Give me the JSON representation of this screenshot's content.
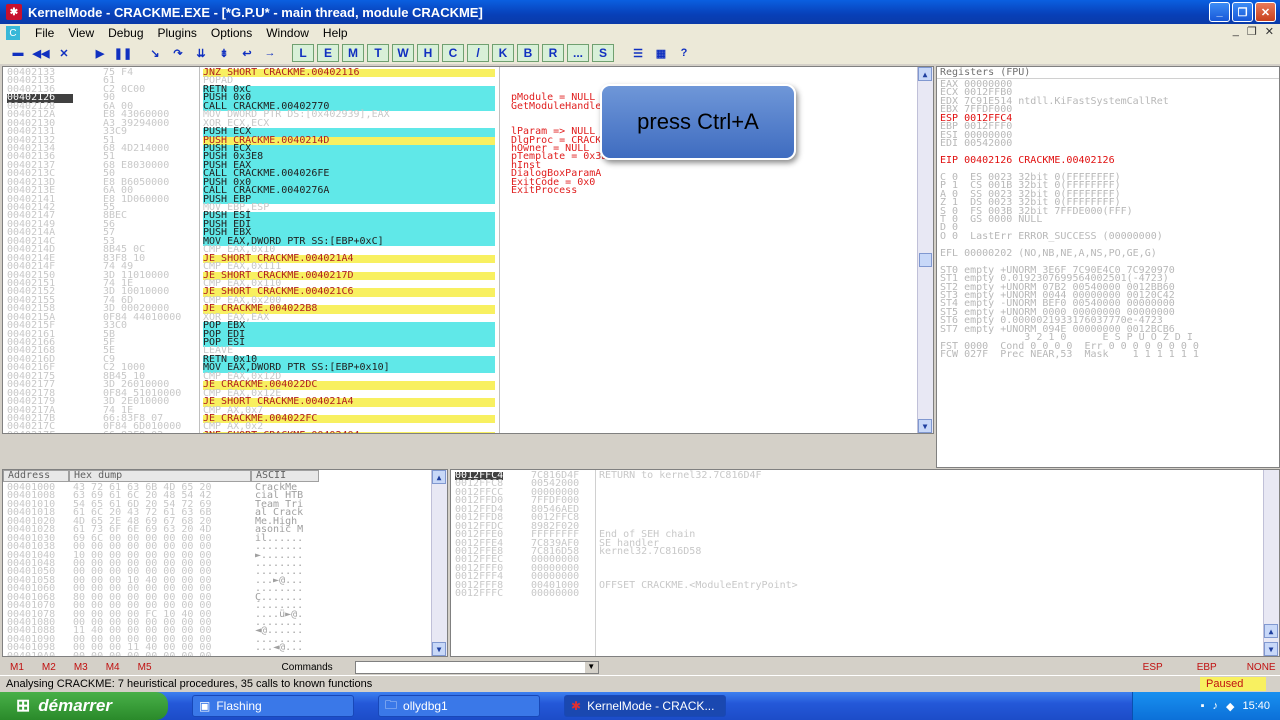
{
  "window": {
    "title": "KernelMode - CRACKME.EXE - [*G.P.U* - main thread, module CRACKME]",
    "icon": "bug-icon"
  },
  "menu": [
    "File",
    "View",
    "Debug",
    "Plugins",
    "Options",
    "Window",
    "Help"
  ],
  "toolbar_letters": [
    "L",
    "E",
    "M",
    "T",
    "W",
    "H",
    "C",
    "/",
    "K",
    "B",
    "R",
    "...",
    "S"
  ],
  "callout": "press  Ctrl+A",
  "disasm": {
    "addresses": [
      "00402133",
      "00402135",
      "00402136",
      "00402126",
      "00402128",
      "0040212A",
      "00402130",
      "00402131",
      "00402132",
      "00402134",
      "00402136",
      "00402137",
      "0040213C",
      "0040213D",
      "0040213E",
      "00402141",
      "00402142",
      "00402147",
      "00402149",
      "0040214A",
      "0040214C",
      "0040214D",
      "0040214E",
      "0040214F",
      "00402150",
      "00402151",
      "00402152",
      "00402155",
      "00402158",
      "0040215A",
      "0040215F",
      "00402161",
      "00402166",
      "00402168",
      "0040216D",
      "0040216F",
      "00402175",
      "00402177",
      "00402178",
      "00402179",
      "0040217A",
      "0040217B",
      "0040217C",
      "0040217F",
      "00402182",
      "00402187",
      "0040218D",
      "00402192",
      "00402194",
      "00402197",
      "0040219D",
      "004021A0",
      "004021A2",
      "004021A3",
      "004021A5"
    ],
    "hex": [
      "75 F4",
      "61",
      "C2 0C00",
      "90",
      "6A 00",
      "E8 43060000",
      "A3 39294000",
      "33C9",
      "51",
      "68 4D214000",
      "51",
      "68 E8030000",
      "50",
      "E8 B6050000",
      "6A 00",
      "E8 1D060000",
      "55",
      "8BEC",
      "56",
      "57",
      "53",
      "8B45 0C",
      "83F8 10",
      "74 49",
      "3D 11010000",
      "74 1E",
      "3D 10010000",
      "74 6D",
      "3D 00020000",
      "0F84 44010000",
      "33C0",
      "5B",
      "5F",
      "5E",
      "C9",
      "C2 1000",
      "8B45 10",
      "3D 26010000",
      "0F84 51010000",
      "3D 2E010000",
      "74 1E",
      "66:83F8 07",
      "0F84 6D010000",
      "66:83F8 02",
      "33 C9"
    ],
    "instr": [
      {
        "t": "JNZ SHORT CRACKME.00402116",
        "k": "y"
      },
      {
        "t": "POPAD",
        "k": ""
      },
      {
        "t": "RETN 0xC",
        "k": "c"
      },
      {
        "t": "PUSH 0x0",
        "k": "c"
      },
      {
        "t": "CALL CRACKME.00402770",
        "k": "c"
      },
      {
        "t": "MOV DWORD PTR DS:[0x402939],EAX",
        "k": ""
      },
      {
        "t": "XOR ECX,ECX",
        "k": ""
      },
      {
        "t": "PUSH ECX",
        "k": "c"
      },
      {
        "t": "PUSH CRACKME.0040214D",
        "k": "y"
      },
      {
        "t": "PUSH ECX",
        "k": "c"
      },
      {
        "t": "PUSH 0x3E8",
        "k": "c"
      },
      {
        "t": "PUSH EAX",
        "k": "c"
      },
      {
        "t": "CALL CRACKME.004026FE",
        "k": "c"
      },
      {
        "t": "PUSH 0x0",
        "k": "c"
      },
      {
        "t": "CALL CRACKME.0040276A",
        "k": "c"
      },
      {
        "t": "PUSH EBP",
        "k": "c"
      },
      {
        "t": "MOV EBP,ESP",
        "k": ""
      },
      {
        "t": "PUSH ESI",
        "k": "c"
      },
      {
        "t": "PUSH EDI",
        "k": "c"
      },
      {
        "t": "PUSH EBX",
        "k": "c"
      },
      {
        "t": "MOV EAX,DWORD PTR SS:[EBP+0xC]",
        "k": "c"
      },
      {
        "t": "CMP EAX,0x10",
        "k": ""
      },
      {
        "t": "JE SHORT CRACKME.004021A4",
        "k": "y"
      },
      {
        "t": "CMP EAX,0x111",
        "k": ""
      },
      {
        "t": "JE SHORT CRACKME.0040217D",
        "k": "y"
      },
      {
        "t": "CMP EAX,0x110",
        "k": ""
      },
      {
        "t": "JE SHORT CRACKME.004021C6",
        "k": "y"
      },
      {
        "t": "CMP EAX,0x200",
        "k": ""
      },
      {
        "t": "JE CRACKME.004022B8",
        "k": "y"
      },
      {
        "t": "XOR EAX,EAX",
        "k": ""
      },
      {
        "t": "POP EBX",
        "k": "c"
      },
      {
        "t": "POP EDI",
        "k": "c"
      },
      {
        "t": "POP ESI",
        "k": "c"
      },
      {
        "t": "LEAVE",
        "k": ""
      },
      {
        "t": "RETN 0x10",
        "k": "c"
      },
      {
        "t": "MOV EAX,DWORD PTR SS:[EBP+0x10]",
        "k": "c"
      },
      {
        "t": "CMP EAX,0x12D",
        "k": ""
      },
      {
        "t": "JE CRACKME.004022DC",
        "k": "y"
      },
      {
        "t": "CMP EAX,0x12E",
        "k": ""
      },
      {
        "t": "JE SHORT CRACKME.004021A4",
        "k": "y"
      },
      {
        "t": "CMP AX,0x7",
        "k": ""
      },
      {
        "t": "JE CRACKME.004022FC",
        "k": "y"
      },
      {
        "t": "CMP AX,0x2",
        "k": ""
      },
      {
        "t": "JNE SHORT CRACKME.00402404",
        "k": "y"
      }
    ],
    "comments": [
      "",
      "",
      "",
      "pModule = NULL",
      "GetModuleHandleA",
      "",
      "",
      "lParam => NULL",
      "DlgProc = CRACKME.0040214D",
      "hOwner = NULL",
      "pTemplate = 0x3E8",
      "hInst",
      "DialogBoxParamA",
      "ExitCode = 0x0",
      "ExitProcess"
    ]
  },
  "registers": {
    "title": "Registers (FPU)",
    "lines": [
      {
        "t": "EAX 00000000",
        "r": false
      },
      {
        "t": "ECX 0012FFB0",
        "r": false
      },
      {
        "t": "EDX 7C91E514 ntdll.KiFastSystemCallRet",
        "r": false
      },
      {
        "t": "EBX 7FFDF000",
        "r": false
      },
      {
        "t": "ESP 0012FFC4",
        "r": true
      },
      {
        "t": "EBP 0012FFF0",
        "r": false
      },
      {
        "t": "ESI 00000000",
        "r": false
      },
      {
        "t": "EDI 00542000",
        "r": false
      },
      {
        "t": "",
        "r": false
      },
      {
        "t": "EIP 00402126 CRACKME.00402126",
        "r": true
      },
      {
        "t": "",
        "r": false
      },
      {
        "t": "C 0  ES 0023 32bit 0(FFFFFFFF)",
        "r": false
      },
      {
        "t": "P 1  CS 001B 32bit 0(FFFFFFFF)",
        "r": false
      },
      {
        "t": "A 0  SS 0023 32bit 0(FFFFFFFF)",
        "r": false
      },
      {
        "t": "Z 1  DS 0023 32bit 0(FFFFFFFF)",
        "r": false
      },
      {
        "t": "S 0  FS 003B 32bit 7FFDE000(FFF)",
        "r": false
      },
      {
        "t": "T 0  GS 0000 NULL",
        "r": false
      },
      {
        "t": "D 0",
        "r": false
      },
      {
        "t": "O 0  LastErr ERROR_SUCCESS (00000000)",
        "r": false
      },
      {
        "t": "",
        "r": false
      },
      {
        "t": "EFL 00000202 (NO,NB,NE,A,NS,PO,GE,G)",
        "r": false
      },
      {
        "t": "",
        "r": false
      },
      {
        "t": "ST0 empty +UNORM 3E6F 7C90E4C0 7C920970",
        "r": false
      },
      {
        "t": "ST1 empty 0.0192307699564002501(-4723)",
        "r": false
      },
      {
        "t": "ST2 empty +UNORM 07B2 00540000 0012BB60",
        "r": false
      },
      {
        "t": "ST3 empty +UNORM 0044 00000000 00120C42",
        "r": false
      },
      {
        "t": "ST4 empty -UNORM BEF0 00540000 00000000",
        "r": false
      },
      {
        "t": "ST5 empty +UNORM 0000 00000000 00000000",
        "r": false
      },
      {
        "t": "ST6 empty 0.0000021933176037770e-4723",
        "r": false
      },
      {
        "t": "ST7 empty +UNORM 094E 00000000 0012BCB6",
        "r": false
      },
      {
        "t": "              3 2 1 0      E S P U O Z D I",
        "r": false
      },
      {
        "t": "FST 0000  Cond 0 0 0 0  Err 0 0 0 0 0 0 0 0",
        "r": false
      },
      {
        "t": "FCW 027F  Prec NEAR,53  Mask    1 1 1 1 1 1",
        "r": false
      }
    ]
  },
  "dump": {
    "headers": [
      "Address",
      "Hex dump",
      "ASCII"
    ],
    "addresses": [
      "00401000",
      "00401008",
      "00401010",
      "00401018",
      "00401020",
      "00401028",
      "00401030",
      "00401038",
      "00401040",
      "00401048",
      "00401050",
      "00401058",
      "00401060",
      "00401068",
      "00401070",
      "00401078",
      "00401080",
      "00401088",
      "00401090",
      "00401098",
      "004010A0"
    ],
    "hex": [
      "43 72 61 63 6B 4D 65 20",
      "63 69 61 6C 20 48 54 42",
      "54 65 61 6D 20 54 72 69",
      "61 6C 20 43 72 61 63 6B",
      "4D 65 2E 48 69 67 68 20",
      "61 73 6F 6E 69 63 20 4D",
      "69 6C 00 00 00 00 00 00",
      "00 00 00 00 00 00 00 00",
      "10 00 00 00 00 00 00 00",
      "00 00 00 00 00 00 00 00",
      "00 00 00 00 00 00 00 00",
      "00 00 00 10 40 00 00 00",
      "00 00 00 00 00 00 00 00",
      "80 00 00 00 00 00 00 00",
      "00 00 00 00 00 00 00 00",
      "00 00 00 00 FC 10 40 00",
      "00 00 00 00 00 00 00 00",
      "11 40 00 00 00 00 00 00",
      "00 00 00 00 00 00 00 00",
      "00 00 00 11 40 00 00 00",
      "00 00 00 00 00 00 00 00"
    ],
    "ascii": [
      "CrackMe ",
      "cial HTB",
      "Team Tri",
      "al Crack",
      "Me.High ",
      "asonic M",
      "il......",
      "........",
      "►.......",
      "........",
      "........",
      "...►@...",
      "........",
      "Ç.......",
      "........",
      "....ü►@.",
      "........",
      "◄@......",
      "........",
      "...◄@...",
      "........"
    ]
  },
  "stack": {
    "addresses": [
      "0012FFC4",
      "0012FFC8",
      "0012FFCC",
      "0012FFD0",
      "0012FFD4",
      "0012FFD8",
      "0012FFDC",
      "0012FFE0",
      "0012FFE4",
      "0012FFE8",
      "0012FFEC",
      "0012FFF0",
      "0012FFF4",
      "0012FFF8",
      "0012FFFC"
    ],
    "values": [
      "7C816D4F",
      "00542000",
      "00000000",
      "7FFDF000",
      "80546AED",
      "0012FFC8",
      "8982F020",
      "FFFFFFFF",
      "7C839AF0",
      "7C816D58",
      "00000000",
      "00000000",
      "00000000",
      "00401000",
      "00000000"
    ],
    "comments": [
      "RETURN to kernel32.7C816D4F",
      "",
      "",
      "",
      "",
      "",
      "",
      "End of SEH chain",
      "SE handler",
      "kernel32.7C816D58",
      "",
      "",
      "",
      "OFFSET CRACKME.<ModuleEntryPoint>",
      ""
    ]
  },
  "fnbar": {
    "items": [
      "M1",
      "M2",
      "M3",
      "M4",
      "M5"
    ],
    "commands_label": "Commands",
    "right": [
      "ESP",
      "EBP",
      "NONE"
    ]
  },
  "status": {
    "text": "Analysing CRACKME: 7 heuristical procedures, 35 calls to known functions",
    "state": "Paused"
  },
  "taskbar": {
    "start": "démarrer",
    "tasks": [
      "Flashing",
      "ollydbg1",
      "KernelMode - CRACK..."
    ],
    "clock": "15:40"
  }
}
